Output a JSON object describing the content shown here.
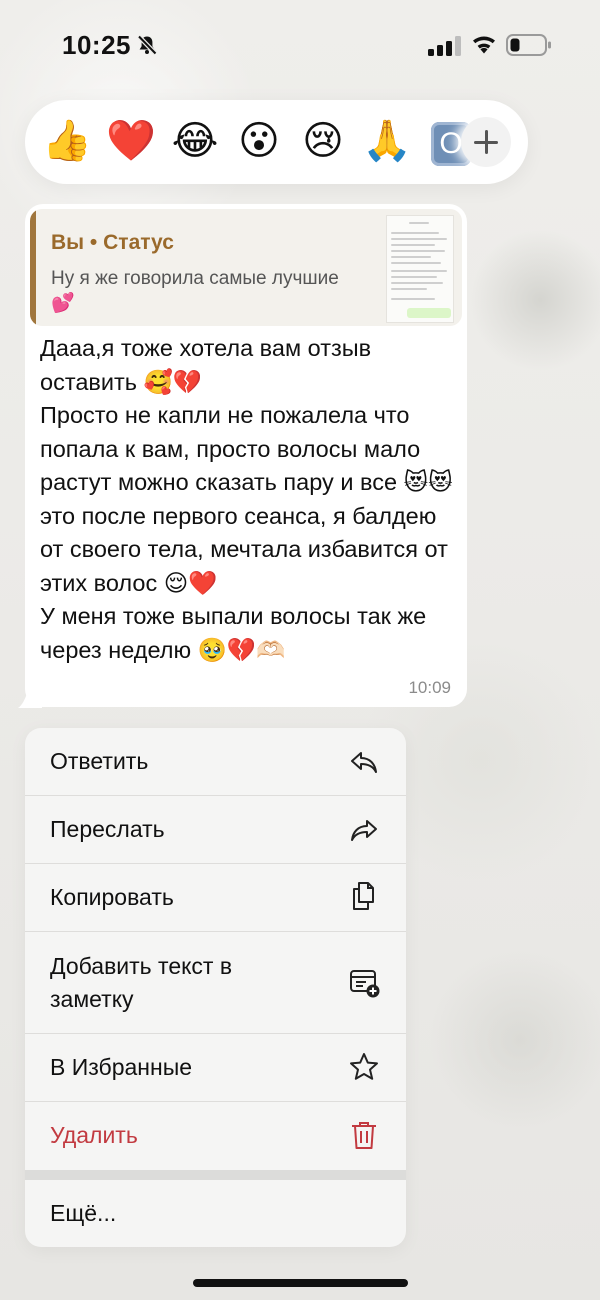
{
  "status_bar": {
    "time": "10:25",
    "icons": [
      "bell-off-icon",
      "signal-icon",
      "wifi-icon",
      "battery-icon"
    ]
  },
  "reactions": {
    "emojis": [
      "👍",
      "❤️",
      "😂",
      "😮",
      "😢",
      "🙏"
    ],
    "partial_more": "O",
    "add_icon": "plus-icon"
  },
  "message": {
    "quote": {
      "author": "Вы • Статус",
      "text": "Ну я же говорила самые лучшие",
      "emoji": "💕"
    },
    "text": "Дааа,я тоже хотела вам отзыв оставить 🥰💔\nПросто не капли не пожалела что попала к вам, просто волосы мало растут можно сказать пару и все 😻😻это после первого сеанса, я балдею от своего тела, мечтала избавится от этих волос 😌❤️\nУ меня тоже выпали волосы так же через неделю 🥹💔🫶🏻",
    "time": "10:09"
  },
  "context_menu": {
    "items": [
      {
        "label": "Ответить",
        "icon": "reply-icon"
      },
      {
        "label": "Переслать",
        "icon": "forward-icon"
      },
      {
        "label": "Копировать",
        "icon": "copy-icon"
      },
      {
        "label": "Добавить текст в\nзаметку",
        "icon": "add-note-icon"
      },
      {
        "label": "В Избранные",
        "icon": "star-icon"
      },
      {
        "label": "Удалить",
        "icon": "trash-icon"
      },
      {
        "label": "Ещё...",
        "icon": ""
      }
    ],
    "destructive_color": "#c23a40"
  },
  "colors": {
    "quote_accent": "#a0763d",
    "background": "#ecebe8"
  }
}
